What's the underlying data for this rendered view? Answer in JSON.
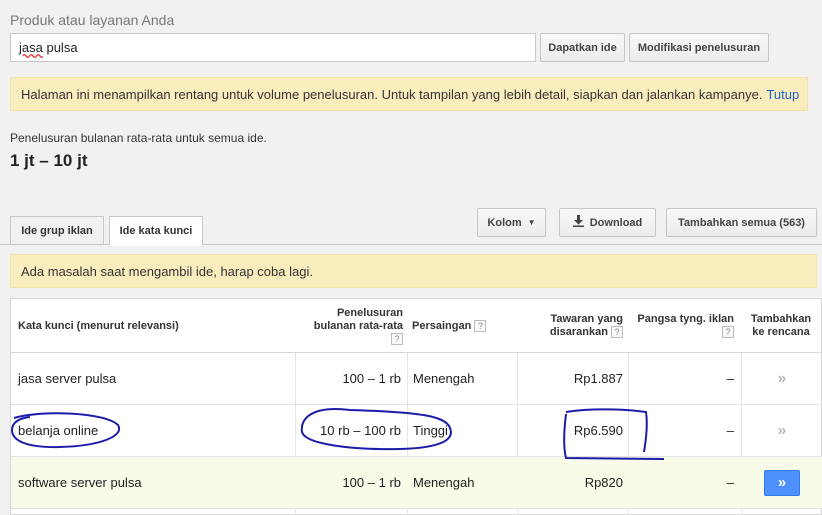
{
  "search": {
    "label": "Produk atau layanan Anda",
    "value_misspelled": "jasa",
    "value_rest": " pulsa",
    "get_ideas_label": "Dapatkan ide",
    "modify_label": "Modifikasi penelusuran"
  },
  "notice_top": {
    "text": "Halaman ini menampilkan rentang untuk volume penelusuran. Untuk tampilan yang lebih detail, siapkan dan jalankan kampanye.",
    "close_label": "Tutup"
  },
  "summary": {
    "label": "Penelusuran bulanan rata-rata untuk semua ide.",
    "value": "1 jt – 10 jt"
  },
  "tabs": [
    {
      "label": "Ide grup iklan"
    },
    {
      "label": "Ide kata kunci"
    }
  ],
  "toolbar": {
    "columns_label": "Kolom",
    "download_label": "Download",
    "add_all_label": "Tambahkan semua (563)"
  },
  "notice_error": {
    "text": "Ada masalah saat mengambil ide, harap coba lagi."
  },
  "table": {
    "headers": {
      "keyword": "Kata kunci (menurut relevansi)",
      "searches_line1": "Penelusuran",
      "searches_line2": "bulanan rata-rata",
      "competition": "Persaingan",
      "bid_line1": "Tawaran yang",
      "bid_line2": "disarankan",
      "share": "Pangsa tyng. iklan",
      "add_line1": "Tambahkan",
      "add_line2": "ke rencana",
      "help_glyph": "?"
    },
    "rows": [
      {
        "keyword": "jasa server pulsa",
        "searches": "100 – 1 rb",
        "competition": "Menengah",
        "bid": "Rp1.887",
        "share": "–",
        "add": "»"
      },
      {
        "keyword": "belanja online",
        "searches": "10 rb – 100 rb",
        "competition": "Tinggi",
        "bid": "Rp6.590",
        "share": "–",
        "add": "»"
      },
      {
        "keyword": "software server pulsa",
        "searches": "100 – 1 rb",
        "competition": "Menengah",
        "bid": "Rp820",
        "share": "–",
        "add": "»"
      }
    ]
  },
  "colors": {
    "notice_bg": "#f9edbe",
    "link": "#1a63c9",
    "primary_button": "#4d90fe",
    "highlight_row": "#f7fbe8",
    "annotation_ink": "#1c1ca8"
  }
}
